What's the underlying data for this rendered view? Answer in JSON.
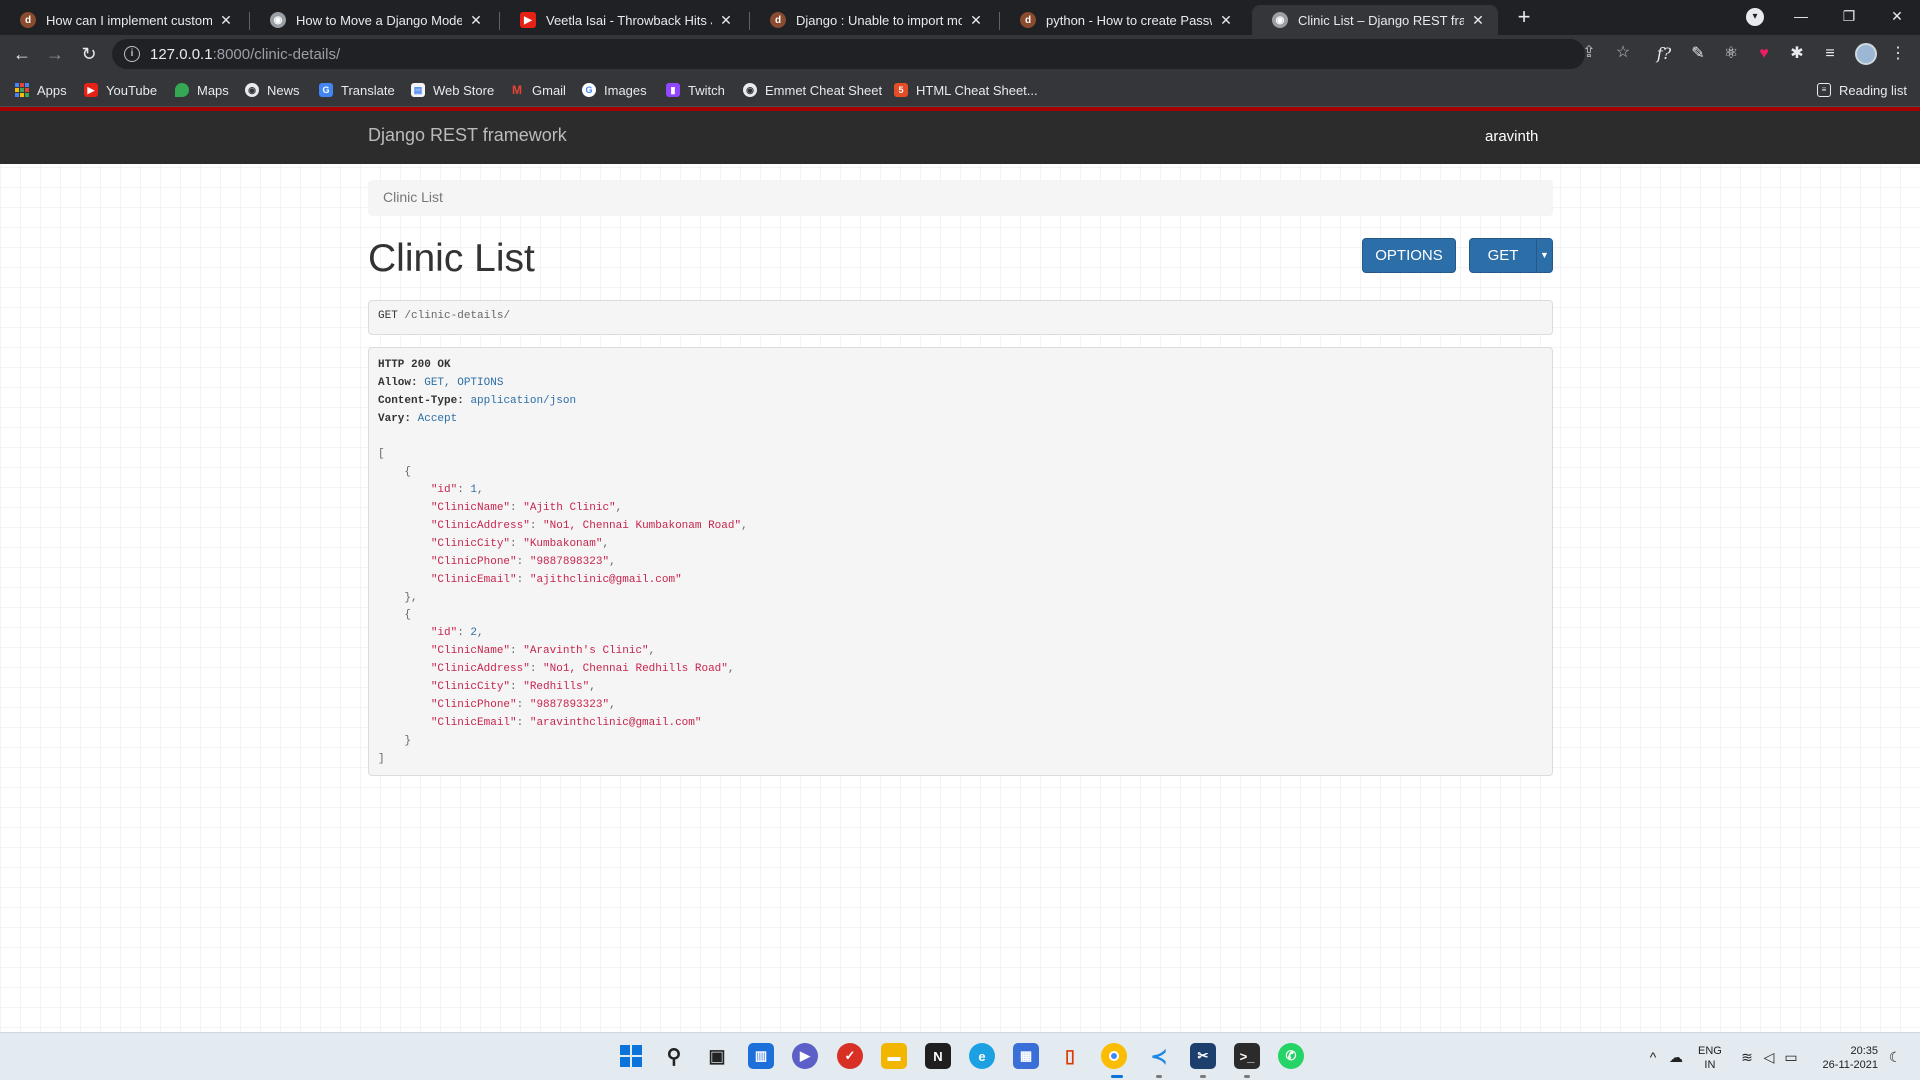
{
  "browser": {
    "tabs": [
      {
        "title": "How can I implement custom use",
        "favicon": "django-icon",
        "active": false
      },
      {
        "title": "How to Move a Django Model to",
        "favicon": "globe-icon",
        "active": false
      },
      {
        "title": "Veetla Isai - Throwback Hits Juke",
        "favicon": "youtube-icon",
        "active": false
      },
      {
        "title": "Django : Unable to import mode",
        "favicon": "django-icon",
        "active": false
      },
      {
        "title": "python - How to create Password",
        "favicon": "django-icon",
        "active": false
      },
      {
        "title": "Clinic List – Django REST framew",
        "favicon": "globe-icon",
        "active": true
      }
    ],
    "url_host": "127.0.0.1",
    "url_rest": ":8000/clinic-details/",
    "bookmarks": [
      {
        "label": "Apps",
        "icon": "apps-grid-icon"
      },
      {
        "label": "YouTube",
        "icon": "youtube-icon"
      },
      {
        "label": "Maps",
        "icon": "maps-icon"
      },
      {
        "label": "News",
        "icon": "news-icon"
      },
      {
        "label": "Translate",
        "icon": "translate-icon"
      },
      {
        "label": "Web Store",
        "icon": "webstore-icon"
      },
      {
        "label": "Gmail",
        "icon": "gmail-icon"
      },
      {
        "label": "Images",
        "icon": "google-icon"
      },
      {
        "label": "Twitch",
        "icon": "twitch-icon"
      },
      {
        "label": "Emmet Cheat Sheet",
        "icon": "globe-icon"
      },
      {
        "label": "HTML Cheat Sheet...",
        "icon": "html5-icon"
      }
    ],
    "reading_list": "Reading list"
  },
  "drf": {
    "brand": "Django REST framework",
    "user": "aravinth",
    "breadcrumb": "Clinic List",
    "title": "Clinic List",
    "btn_options": "OPTIONS",
    "btn_get": "GET",
    "request_method": "GET",
    "request_path": "/clinic-details/",
    "response": {
      "status": "HTTP 200 OK",
      "allow_key": "Allow:",
      "allow_val": "GET, OPTIONS",
      "ctype_key": "Content-Type:",
      "ctype_val": "application/json",
      "vary_key": "Vary:",
      "vary_val": "Accept",
      "records": [
        {
          "id": "1",
          "ClinicName": "\"Ajith Clinic\"",
          "ClinicAddress": "\"No1, Chennai Kumbakonam Road\"",
          "ClinicCity": "\"Kumbakonam\"",
          "ClinicPhone": "\"9887898323\"",
          "ClinicEmail": "\"ajithclinic@gmail.com\""
        },
        {
          "id": "2",
          "ClinicName": "\"Aravinth's Clinic\"",
          "ClinicAddress": "\"No1, Chennai Redhills Road\"",
          "ClinicCity": "\"Redhills\"",
          "ClinicPhone": "\"9887893323\"",
          "ClinicEmail": "\"aravinthclinic@gmail.com\""
        }
      ]
    }
  },
  "taskbar": {
    "lang_top": "ENG",
    "lang_bottom": "IN",
    "time": "20:35",
    "date": "26-11-2021"
  },
  "colors": {
    "drf_accent": "#a30000",
    "drf_button": "#2c6ea7",
    "json_string": "#c7254e"
  }
}
